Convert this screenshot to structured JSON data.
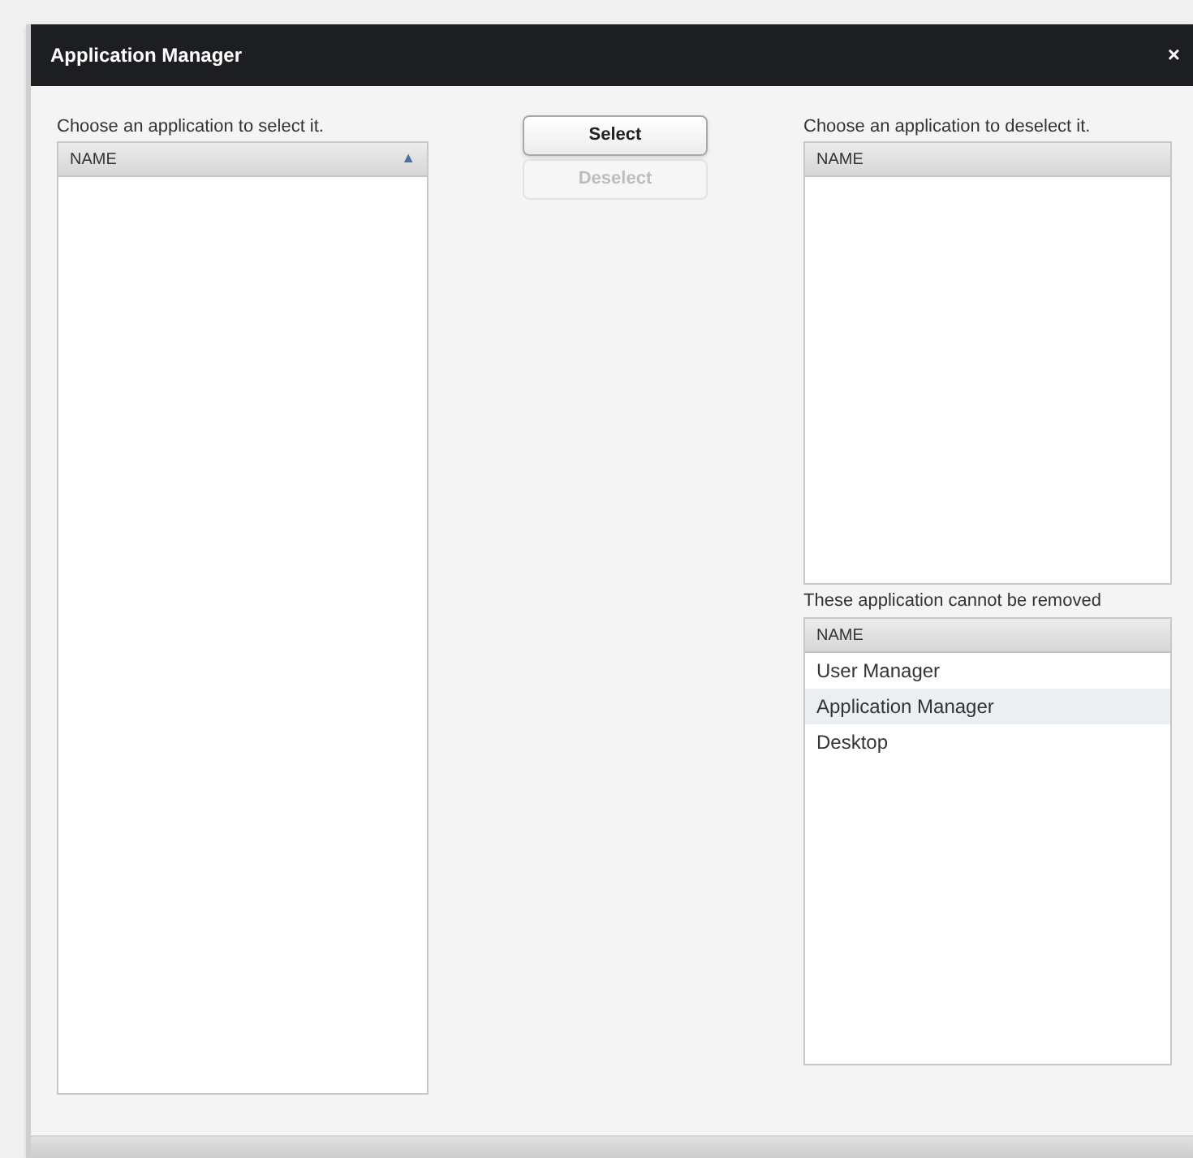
{
  "window": {
    "title": "Application Manager",
    "close": "×"
  },
  "available": {
    "label": "Choose an application to select it.",
    "column": "NAME",
    "sort_indicator": "▲"
  },
  "buttons": [
    {
      "label": "Select",
      "disabled": false
    },
    {
      "label": "Deselect",
      "disabled": true
    }
  ],
  "selected_list": {
    "label": "Choose an application to deselect it.",
    "column": "NAME"
  },
  "fixed_list": {
    "label": "These application cannot be removed",
    "column": "NAME",
    "rows": [
      {
        "name": "User Manager",
        "selected": false
      },
      {
        "name": "Application Manager",
        "selected": true
      },
      {
        "name": "Desktop",
        "selected": false
      }
    ]
  }
}
